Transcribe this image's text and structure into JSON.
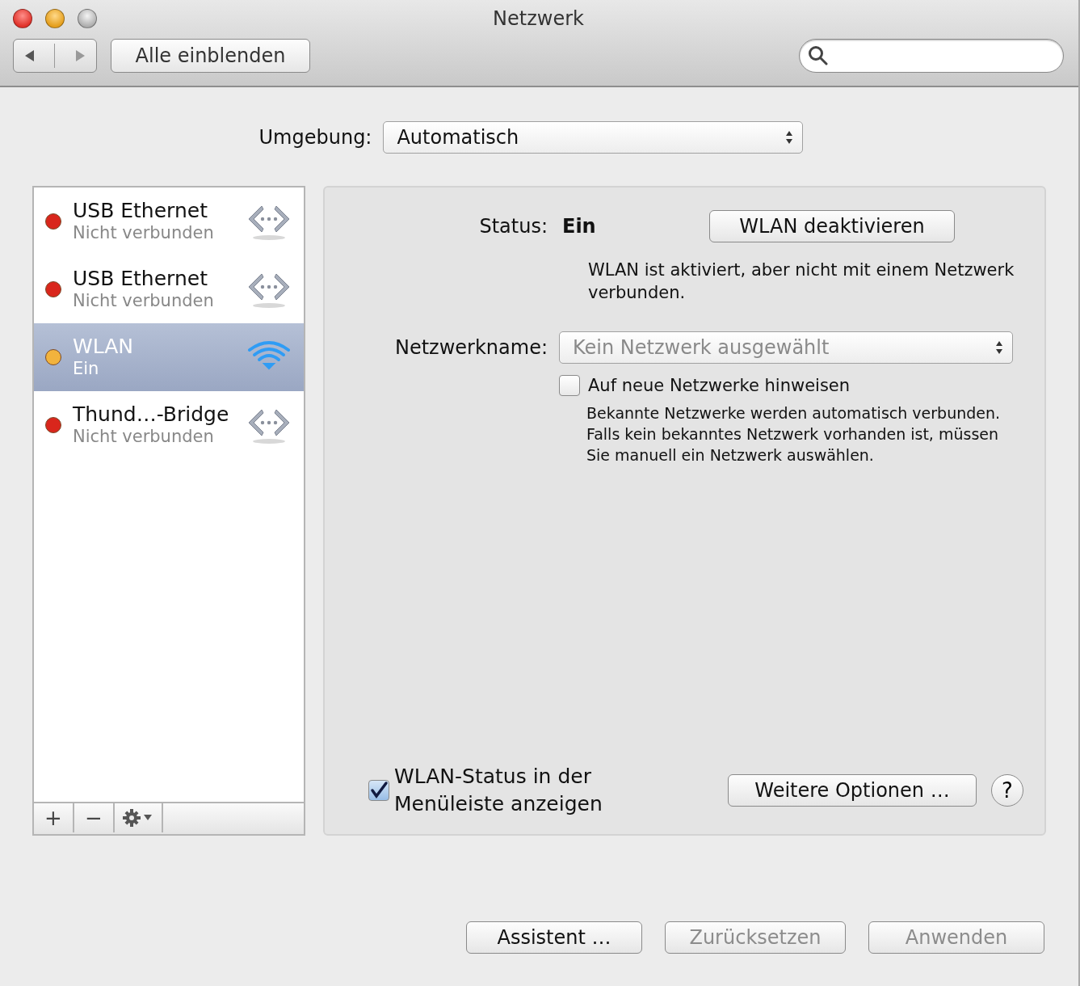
{
  "window": {
    "title": "Netzwerk"
  },
  "toolbar": {
    "show_all": "Alle einblenden"
  },
  "location": {
    "label": "Umgebung:",
    "value": "Automatisch"
  },
  "services": [
    {
      "kind": "ethernet",
      "name": "USB Ethernet",
      "status": "Nicht verbunden",
      "color": "#d9261c",
      "selected": false
    },
    {
      "kind": "ethernet",
      "name": "USB Ethernet",
      "status": "Nicht verbunden",
      "color": "#d9261c",
      "selected": false
    },
    {
      "kind": "wifi",
      "name": "WLAN",
      "status": "Ein",
      "color": "#f2b33d",
      "selected": true
    },
    {
      "kind": "ethernet",
      "name": "Thund…-Bridge",
      "status": "Nicht verbunden",
      "color": "#d9261c",
      "selected": false
    }
  ],
  "service_tools": [
    "+",
    "−"
  ],
  "detail": {
    "status_label": "Status:",
    "status_value": "Ein",
    "toggle_button": "WLAN deaktivieren",
    "status_text": "WLAN ist aktiviert, aber nicht mit einem Netzwerk verbunden.",
    "network_label": "Netzwerkname:",
    "network_popup": {
      "value": "Kein Netzwerk ausgewählt",
      "disabled": true
    },
    "ask_checkbox": {
      "label": "Auf neue Netzwerke hinweisen",
      "checked": false
    },
    "hint": "Bekannte Netzwerke werden automatisch verbunden. Falls kein bekanntes Netzwerk vorhanden ist, müssen Sie manuell ein Netzwerk auswählen.",
    "menu_checkbox": {
      "label": "WLAN-Status in der Menüleiste anzeigen",
      "checked": true
    },
    "advanced_button": "Weitere Optionen …",
    "help": "?"
  },
  "footer_buttons": [
    {
      "label": "Assistent …",
      "disabled": false
    },
    {
      "label": "Zurücksetzen",
      "disabled": true
    },
    {
      "label": "Anwenden",
      "disabled": true
    }
  ]
}
